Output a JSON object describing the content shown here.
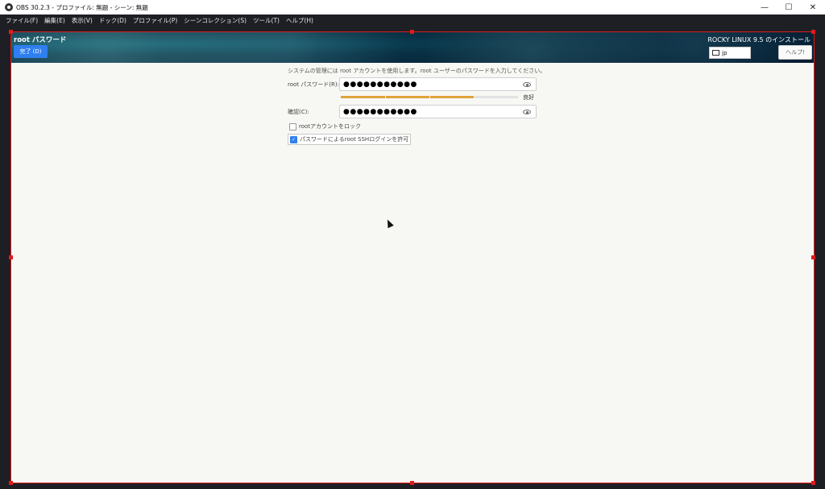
{
  "window": {
    "title": "OBS 30.2.3 - プロファイル: 無題 - シーン: 無題",
    "controls": {
      "minimize": "—",
      "maximize": "☐",
      "close": "✕"
    }
  },
  "menu": {
    "items": [
      "ファイル(F)",
      "編集(E)",
      "表示(V)",
      "ドック(D)",
      "プロファイル(P)",
      "シーンコレクション(S)",
      "ツール(T)",
      "ヘルプ(H)"
    ]
  },
  "installer": {
    "spoke_title": "root パスワード",
    "done_label": "完了 (D)",
    "install_title": "ROCKY LINUX 9.5 のインストール",
    "keyboard_layout": "jp",
    "help_label": "ヘルプ!",
    "info_text": "システムの管理には root アカウントを使用します。root ユーザーのパスワードを入力してください。",
    "root_pw_label": "root パスワード(R):",
    "root_pw_value": "●●●●●●●●●●●",
    "strength_label": "良好",
    "strength_fraction": 0.75,
    "confirm_label": "確認(C):",
    "confirm_value": "●●●●●●●●●●●",
    "lock_root_label": "rootアカウントをロック",
    "lock_root_checked": false,
    "ssh_login_label": "パスワードによるroot SSHログインを許可",
    "ssh_login_checked": true,
    "checkmark": "✓"
  },
  "colors": {
    "accent": "#2f7ff0",
    "selection_frame": "#e01b1b",
    "strength_bar": "#e0a23a"
  }
}
